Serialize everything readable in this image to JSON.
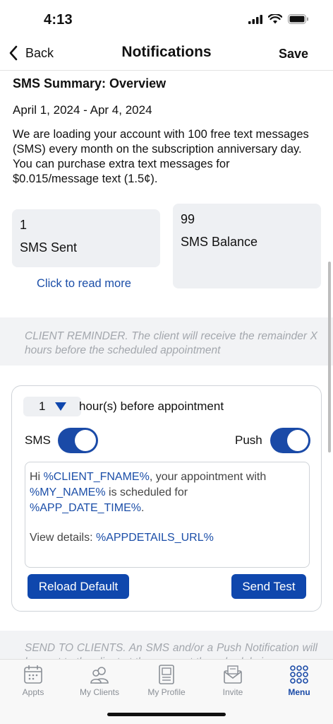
{
  "status_bar": {
    "time": "4:13"
  },
  "nav": {
    "back_label": "Back",
    "title": "Notifications",
    "save_label": "Save"
  },
  "summary": {
    "title": "SMS Summary: Overview",
    "date_range": "April 1, 2024 - Apr 4, 2024",
    "intro": "We are loading your account with 100 free text messages (SMS) every month on the subscription anniversary day. You can purchase extra text messages for $0.015/message text (1.5¢).",
    "sent_count": "1",
    "sent_label": "SMS Sent",
    "balance_count": "99",
    "balance_label": "SMS Balance",
    "read_more": "Click to read more"
  },
  "client_reminder": {
    "info": "CLIENT REMINDER. The client will receive the remainder X hours before the scheduled appointment",
    "hours_value": "1",
    "hours_label": "hour(s) before appointment",
    "sms_label": "SMS",
    "sms_enabled": true,
    "push_label": "Push",
    "push_enabled": true,
    "message": {
      "t1": "Hi ",
      "v1": "%CLIENT_FNAME%",
      "t2": ", your appointment with ",
      "v2": "%MY_NAME%",
      "t3": " is scheduled for ",
      "v3": "%APP_DATE_TIME%",
      "t4": ".",
      "t5": "View details: ",
      "v4": "%APPDETAILS_URL%"
    },
    "reload_label": "Reload Default",
    "send_test_label": "Send Test"
  },
  "send_to_clients": {
    "info": "SEND TO CLIENTS. An SMS and/or a Push Notification will be sent to the client at the moment the schedule is..."
  },
  "tabs": [
    {
      "label": "Appts",
      "icon": "calendar-icon"
    },
    {
      "label": "My Clients",
      "icon": "clients-icon"
    },
    {
      "label": "My Profile",
      "icon": "profile-icon"
    },
    {
      "label": "Invite",
      "icon": "envelope-icon"
    },
    {
      "label": "Menu",
      "icon": "grid-menu-icon",
      "active": true
    }
  ],
  "colors": {
    "accent": "#1a4aa7",
    "link": "#1b4ea8",
    "card_bg": "#eef0f3",
    "muted_text": "#a3a7ad"
  }
}
